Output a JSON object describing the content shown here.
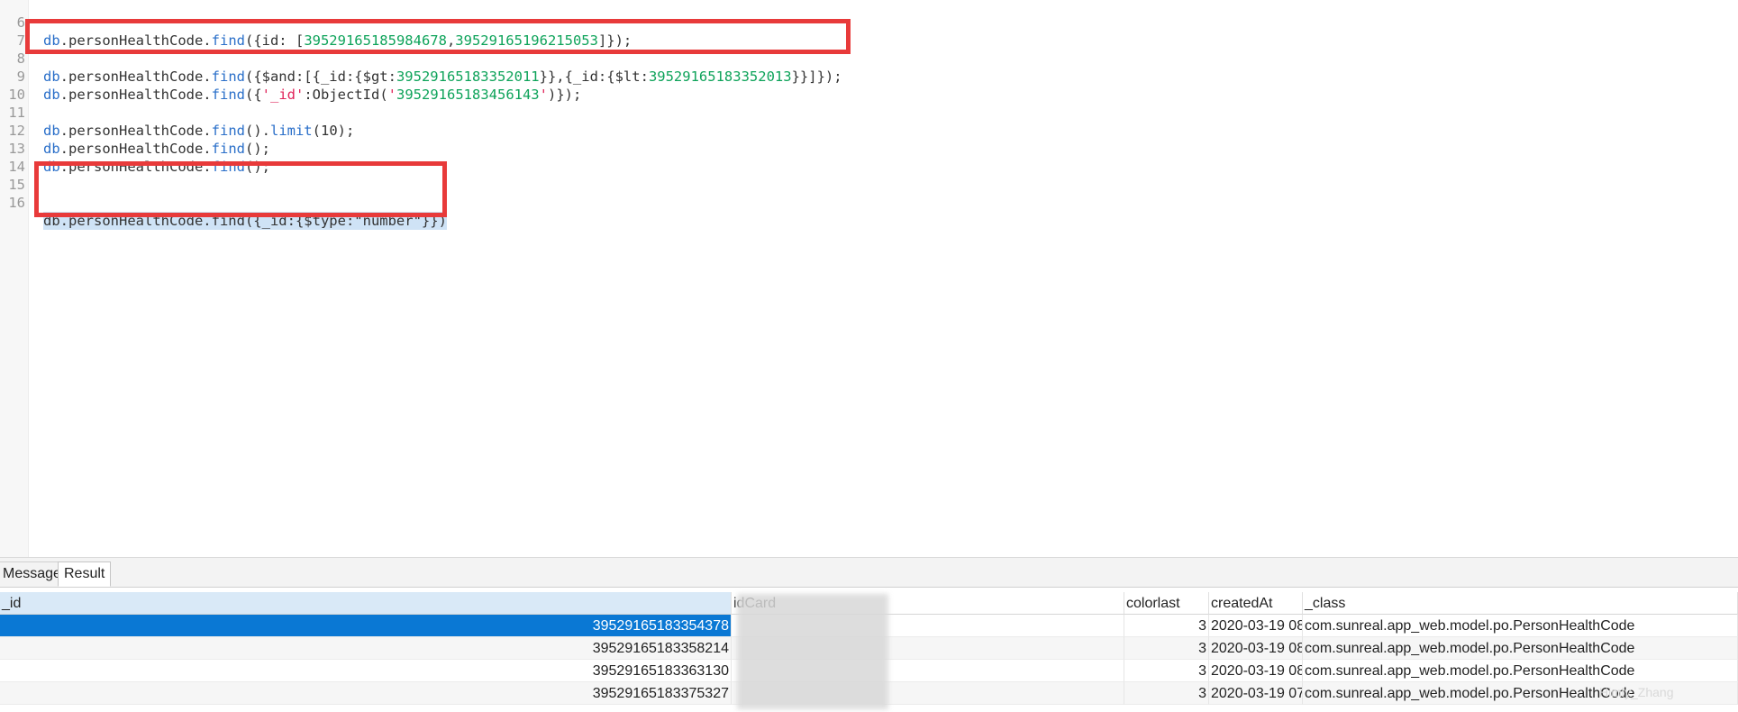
{
  "editor": {
    "lines": [
      {
        "num": "6",
        "text": "db.personHealthCode.find({id: [39529165185984678,39529165196215053]});"
      },
      {
        "num": "7",
        "text": ""
      },
      {
        "num": "8",
        "text": "db.personHealthCode.find({$and:[{_id:{$gt:39529165183352011}},{_id:{$lt:39529165183352013}}]});"
      },
      {
        "num": "9",
        "text": "db.personHealthCode.find({'_id':ObjectId('39529165183456143')});"
      },
      {
        "num": "10",
        "text": ""
      },
      {
        "num": "11",
        "text": "db.personHealthCode.find().limit(10);"
      },
      {
        "num": "12",
        "text": "db.personHealthCode.find();"
      },
      {
        "num": "13",
        "text": "db.personHealthCode.find();"
      },
      {
        "num": "14",
        "text": ""
      },
      {
        "num": "15",
        "text": ""
      },
      {
        "num": "16",
        "text": "db.personHealthCode.find({_id:{$type:\"number\"}})"
      }
    ]
  },
  "colors": {
    "highlight_border": "#e83a3a",
    "selection": "#cfe3f6",
    "selected_row": "#0a78d4",
    "keyword": "#2a6fc9",
    "number": "#0ea35a",
    "string": "#e0245a"
  },
  "tabs": {
    "message": "Message",
    "result": "Result"
  },
  "grid": {
    "headers": {
      "id": "_id",
      "idcard": "idCard",
      "colorlast": "colorlast",
      "createdAt": "createdAt",
      "class": "_class"
    },
    "rows": [
      {
        "id": "39529165183354378",
        "colorlast": "3",
        "createdAt": "2020-03-19 08",
        "class": "com.sunreal.app_web.model.po.PersonHealthCode"
      },
      {
        "id": "39529165183358214",
        "colorlast": "3",
        "createdAt": "2020-03-19 08",
        "class": "com.sunreal.app_web.model.po.PersonHealthCode"
      },
      {
        "id": "39529165183363130",
        "colorlast": "3",
        "createdAt": "2020-03-19 08",
        "class": "com.sunreal.app_web.model.po.PersonHealthCode"
      },
      {
        "id": "39529165183375327",
        "colorlast": "3",
        "createdAt": "2020-03-19 07",
        "class": "com.sunreal.app_web.model.po.PersonHealthCode"
      }
    ]
  },
  "watermark": "Himly_Zhang"
}
